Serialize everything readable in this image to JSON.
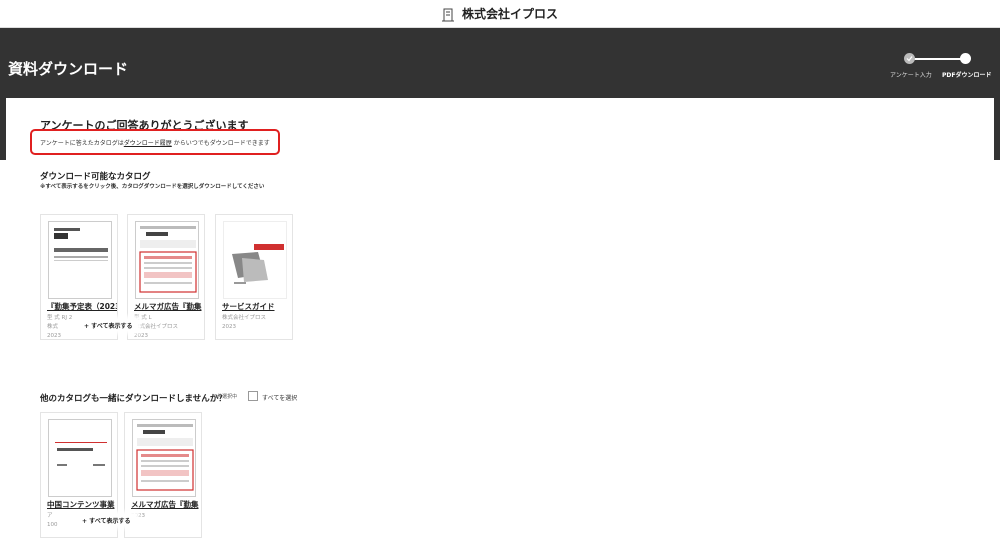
{
  "header": {
    "brand": "株式会社イプロス",
    "logo_icon": "building-icon"
  },
  "page": {
    "title": "資料ダウンロード"
  },
  "steps": [
    {
      "label": "アンケート入力",
      "state": "done"
    },
    {
      "label": "PDFダウンロード",
      "state": "current"
    }
  ],
  "thanks": {
    "heading": "アンケートのご回答ありがとうございます",
    "note_pre": "アンケートに答えたカタログは",
    "note_link": "ダウンロード履歴",
    "note_post": "からいつでもダウンロードできます"
  },
  "downloadable": {
    "title": "ダウンロード可能なカタログ",
    "subtitle": "※すべて表示するをクリック後、カタログダウンロードを選択しダウンロードしてください",
    "show_all": "+ すべて表示する",
    "cards": [
      {
        "title": "『勤集予定表（2023",
        "meta1": "型 式 RJ 2",
        "meta2": "株式",
        "meta3": "2023"
      },
      {
        "title": "メルマガ広告『勤集",
        "meta1": "型 式 L",
        "meta2": "株式会社イプロス",
        "meta3": "2023"
      },
      {
        "title": "サービスガイド",
        "meta1": "株式会社イプロス",
        "meta2": "2023",
        "meta3": ""
      }
    ]
  },
  "others": {
    "title": "他のカタログも一緒にダウンロードしませんか？",
    "selected_count": "0件選択中",
    "select_all": "すべてを選択",
    "show_all": "+ すべて表示する",
    "cards": [
      {
        "title": "中国コンテンツ事業",
        "meta1": "ア",
        "meta2": "100",
        "meta3": ""
      },
      {
        "title": "メルマガ広告『勤集",
        "meta1": "",
        "meta2": "",
        "meta3": "2023"
      }
    ]
  },
  "colors": {
    "dark_band": "#333333",
    "highlight_border": "#e02020",
    "thumb_red": "#d03030"
  }
}
